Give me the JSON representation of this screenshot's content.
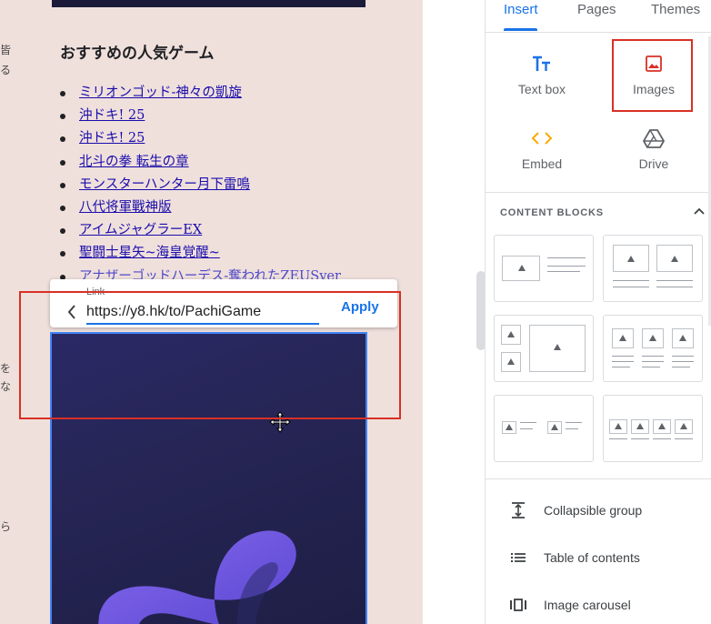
{
  "canvas": {
    "heading": "おすすめの人気ゲーム",
    "games": [
      "ミリオンゴッド-神々の凱旋",
      "沖ドキ! 25",
      "沖ドキ! 25",
      "北斗の拳 転生の章",
      "モンスターハンター月下雷鳴",
      "八代将軍戰神版",
      "アイムジャグラーEX",
      "聖闘士星矢~海皇覚醒~",
      "アナザーゴッドハーデス-奪われたZEUSver"
    ],
    "left_edge_chars": [
      "皆",
      "る",
      "を",
      "な",
      "ら"
    ],
    "link_popup": {
      "label": "Link",
      "url": "https://y8.hk/to/PachiGame",
      "apply": "Apply"
    }
  },
  "panel": {
    "tabs": [
      "Insert",
      "Pages",
      "Themes"
    ],
    "active_tab": "Insert",
    "insert_items": [
      {
        "label": "Text box",
        "icon": "text-box-icon"
      },
      {
        "label": "Images",
        "icon": "image-icon"
      },
      {
        "label": "Embed",
        "icon": "embed-icon"
      },
      {
        "label": "Drive",
        "icon": "drive-icon"
      }
    ],
    "content_blocks_title": "CONTENT BLOCKS",
    "list_items": [
      {
        "label": "Collapsible group",
        "icon": "collapsible-group-icon"
      },
      {
        "label": "Table of contents",
        "icon": "table-of-contents-icon"
      },
      {
        "label": "Image carousel",
        "icon": "image-carousel-icon"
      }
    ]
  },
  "colors": {
    "accent": "#1a73e8",
    "highlight_box": "#d93025",
    "canvas_bg": "#f0e0dc",
    "link": "#1a0dab",
    "image_bg": "#262555",
    "logo_purple": "#7b5cf0"
  }
}
